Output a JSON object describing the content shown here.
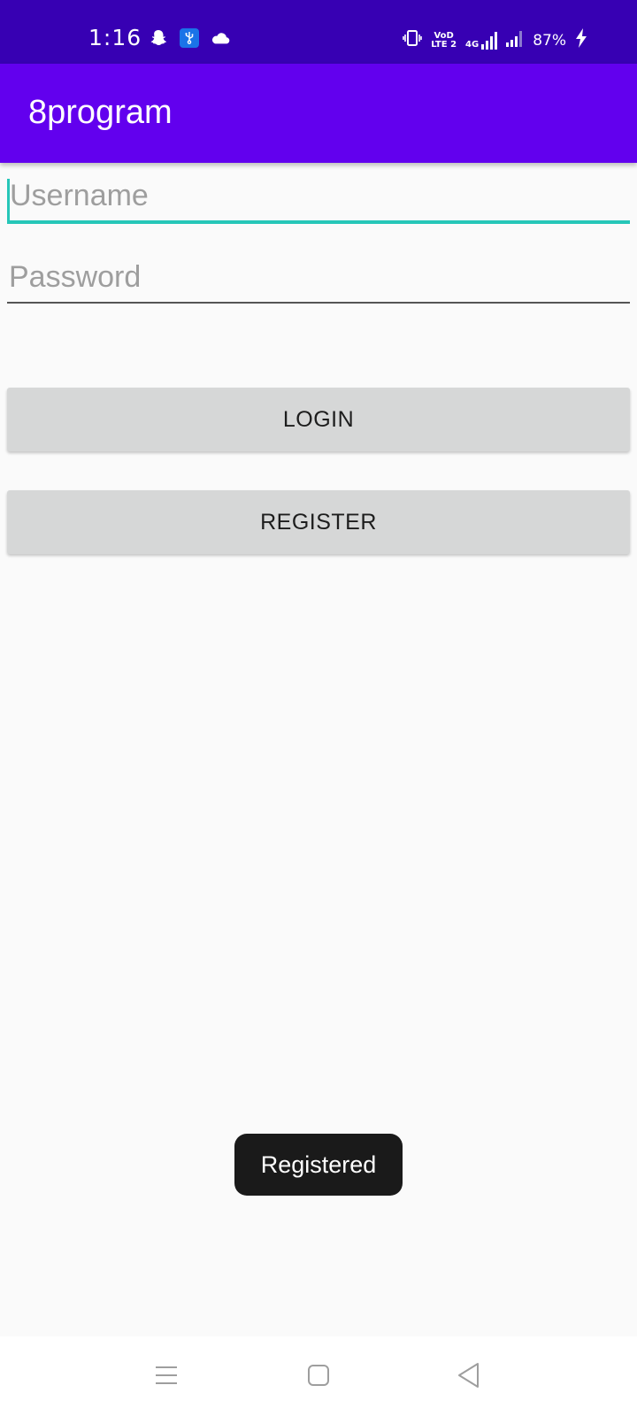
{
  "status_bar": {
    "time": "1:16",
    "battery": "87%",
    "network_vo": "VoD",
    "network_lte": "LTE 2",
    "network_type": "4G"
  },
  "app_bar": {
    "title": "8program"
  },
  "form": {
    "username_placeholder": "Username",
    "password_placeholder": "Password",
    "login_label": "LOGIN",
    "register_label": "REGISTER"
  },
  "toast": {
    "message": "Registered"
  },
  "colors": {
    "status_bar": "#3700b3",
    "app_bar": "#6200ee",
    "accent": "#26c6b8",
    "button": "#d6d7d7",
    "toast": "#1a1a1a"
  },
  "icons": {
    "status_left": [
      "snapchat-icon",
      "usb-debug-icon",
      "cloud-icon"
    ],
    "status_right": [
      "vibrate-icon",
      "volte-icon",
      "4g-signal-icon",
      "signal-icon",
      "battery-charging-icon"
    ],
    "nav": [
      "recent-apps-icon",
      "home-icon",
      "back-icon"
    ]
  }
}
